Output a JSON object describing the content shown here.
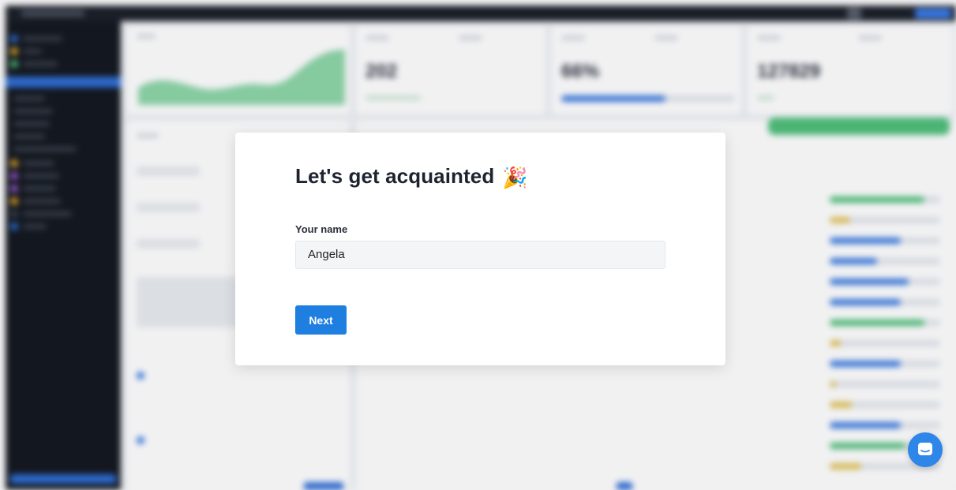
{
  "modal": {
    "title": "Let's get acquainted",
    "title_emoji": "🎉",
    "name_label": "Your name",
    "name_value": "Angela",
    "next_label": "Next"
  },
  "background": {
    "stats": [
      {
        "value": "202"
      },
      {
        "value": "66%",
        "progress": 0.6
      },
      {
        "value": "127829"
      }
    ]
  },
  "chat_widget": {
    "icon": "chat-bubble-icon"
  },
  "colors": {
    "primary": "#1e7fe0",
    "sidebar": "#14181f",
    "success": "#4fbf7a"
  }
}
